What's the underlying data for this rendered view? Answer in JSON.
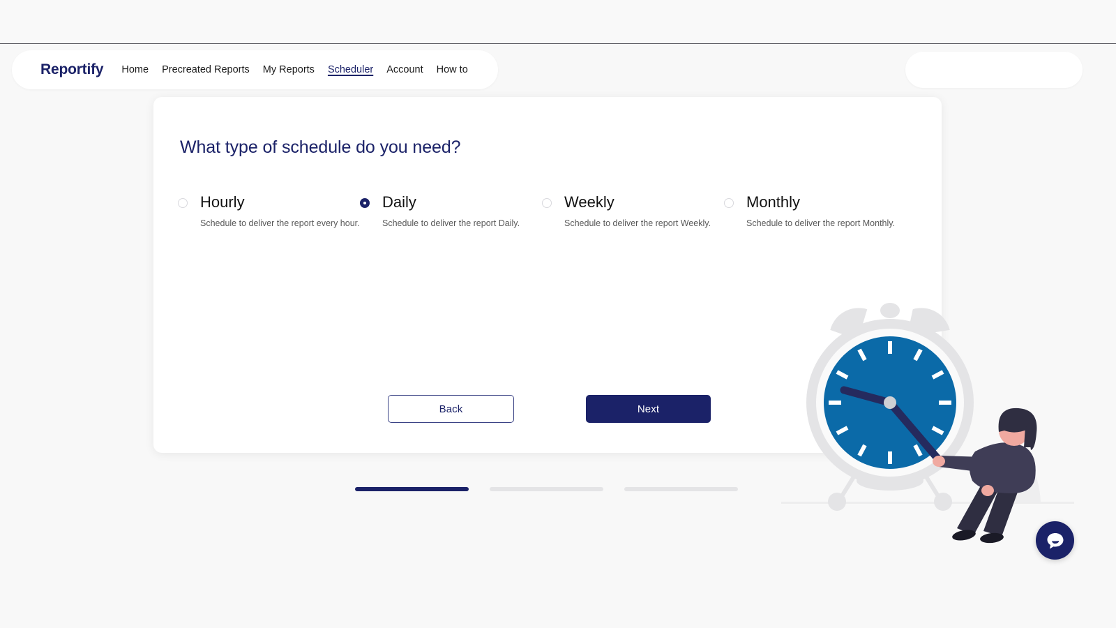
{
  "navbar": {
    "brand": "Reportify",
    "links": [
      {
        "label": "Home",
        "active": false
      },
      {
        "label": "Precreated Reports",
        "active": false
      },
      {
        "label": "My Reports",
        "active": false
      },
      {
        "label": "Scheduler",
        "active": true
      },
      {
        "label": "Account",
        "active": false
      },
      {
        "label": "How to",
        "active": false
      }
    ]
  },
  "card": {
    "title": "What type of schedule do you need?",
    "options": [
      {
        "label": "Hourly",
        "description": "Schedule to deliver the report every hour.",
        "selected": false
      },
      {
        "label": "Daily",
        "description": "Schedule to deliver the report Daily.",
        "selected": true
      },
      {
        "label": "Weekly",
        "description": "Schedule to deliver the report Weekly.",
        "selected": false
      },
      {
        "label": "Monthly",
        "description": "Schedule to deliver the report Monthly.",
        "selected": false
      }
    ],
    "buttons": {
      "back": "Back",
      "next": "Next"
    },
    "illustration": "alarm-clock-with-person"
  },
  "progress": {
    "steps": 3,
    "current": 1
  },
  "chat": {
    "icon": "chat-bubble-icon"
  },
  "colors": {
    "navy": "#1b2268",
    "clock_blue": "#0b6aa8",
    "page_background": "#f8f8f8",
    "card_background": "#ffffff",
    "step_inactive": "#e4e4e6",
    "description_text": "#585858"
  }
}
